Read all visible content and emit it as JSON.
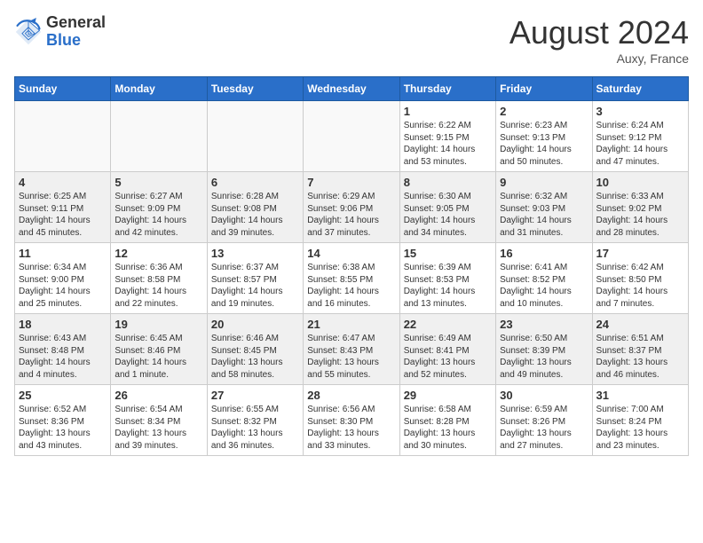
{
  "header": {
    "logo_general": "General",
    "logo_blue": "Blue",
    "month_title": "August 2024",
    "subtitle": "Auxy, France"
  },
  "days_of_week": [
    "Sunday",
    "Monday",
    "Tuesday",
    "Wednesday",
    "Thursday",
    "Friday",
    "Saturday"
  ],
  "weeks": [
    [
      {
        "day": "",
        "info": ""
      },
      {
        "day": "",
        "info": ""
      },
      {
        "day": "",
        "info": ""
      },
      {
        "day": "",
        "info": ""
      },
      {
        "day": "1",
        "info": "Sunrise: 6:22 AM\nSunset: 9:15 PM\nDaylight: 14 hours and 53 minutes."
      },
      {
        "day": "2",
        "info": "Sunrise: 6:23 AM\nSunset: 9:13 PM\nDaylight: 14 hours and 50 minutes."
      },
      {
        "day": "3",
        "info": "Sunrise: 6:24 AM\nSunset: 9:12 PM\nDaylight: 14 hours and 47 minutes."
      }
    ],
    [
      {
        "day": "4",
        "info": "Sunrise: 6:25 AM\nSunset: 9:11 PM\nDaylight: 14 hours and 45 minutes."
      },
      {
        "day": "5",
        "info": "Sunrise: 6:27 AM\nSunset: 9:09 PM\nDaylight: 14 hours and 42 minutes."
      },
      {
        "day": "6",
        "info": "Sunrise: 6:28 AM\nSunset: 9:08 PM\nDaylight: 14 hours and 39 minutes."
      },
      {
        "day": "7",
        "info": "Sunrise: 6:29 AM\nSunset: 9:06 PM\nDaylight: 14 hours and 37 minutes."
      },
      {
        "day": "8",
        "info": "Sunrise: 6:30 AM\nSunset: 9:05 PM\nDaylight: 14 hours and 34 minutes."
      },
      {
        "day": "9",
        "info": "Sunrise: 6:32 AM\nSunset: 9:03 PM\nDaylight: 14 hours and 31 minutes."
      },
      {
        "day": "10",
        "info": "Sunrise: 6:33 AM\nSunset: 9:02 PM\nDaylight: 14 hours and 28 minutes."
      }
    ],
    [
      {
        "day": "11",
        "info": "Sunrise: 6:34 AM\nSunset: 9:00 PM\nDaylight: 14 hours and 25 minutes."
      },
      {
        "day": "12",
        "info": "Sunrise: 6:36 AM\nSunset: 8:58 PM\nDaylight: 14 hours and 22 minutes."
      },
      {
        "day": "13",
        "info": "Sunrise: 6:37 AM\nSunset: 8:57 PM\nDaylight: 14 hours and 19 minutes."
      },
      {
        "day": "14",
        "info": "Sunrise: 6:38 AM\nSunset: 8:55 PM\nDaylight: 14 hours and 16 minutes."
      },
      {
        "day": "15",
        "info": "Sunrise: 6:39 AM\nSunset: 8:53 PM\nDaylight: 14 hours and 13 minutes."
      },
      {
        "day": "16",
        "info": "Sunrise: 6:41 AM\nSunset: 8:52 PM\nDaylight: 14 hours and 10 minutes."
      },
      {
        "day": "17",
        "info": "Sunrise: 6:42 AM\nSunset: 8:50 PM\nDaylight: 14 hours and 7 minutes."
      }
    ],
    [
      {
        "day": "18",
        "info": "Sunrise: 6:43 AM\nSunset: 8:48 PM\nDaylight: 14 hours and 4 minutes."
      },
      {
        "day": "19",
        "info": "Sunrise: 6:45 AM\nSunset: 8:46 PM\nDaylight: 14 hours and 1 minute."
      },
      {
        "day": "20",
        "info": "Sunrise: 6:46 AM\nSunset: 8:45 PM\nDaylight: 13 hours and 58 minutes."
      },
      {
        "day": "21",
        "info": "Sunrise: 6:47 AM\nSunset: 8:43 PM\nDaylight: 13 hours and 55 minutes."
      },
      {
        "day": "22",
        "info": "Sunrise: 6:49 AM\nSunset: 8:41 PM\nDaylight: 13 hours and 52 minutes."
      },
      {
        "day": "23",
        "info": "Sunrise: 6:50 AM\nSunset: 8:39 PM\nDaylight: 13 hours and 49 minutes."
      },
      {
        "day": "24",
        "info": "Sunrise: 6:51 AM\nSunset: 8:37 PM\nDaylight: 13 hours and 46 minutes."
      }
    ],
    [
      {
        "day": "25",
        "info": "Sunrise: 6:52 AM\nSunset: 8:36 PM\nDaylight: 13 hours and 43 minutes."
      },
      {
        "day": "26",
        "info": "Sunrise: 6:54 AM\nSunset: 8:34 PM\nDaylight: 13 hours and 39 minutes."
      },
      {
        "day": "27",
        "info": "Sunrise: 6:55 AM\nSunset: 8:32 PM\nDaylight: 13 hours and 36 minutes."
      },
      {
        "day": "28",
        "info": "Sunrise: 6:56 AM\nSunset: 8:30 PM\nDaylight: 13 hours and 33 minutes."
      },
      {
        "day": "29",
        "info": "Sunrise: 6:58 AM\nSunset: 8:28 PM\nDaylight: 13 hours and 30 minutes."
      },
      {
        "day": "30",
        "info": "Sunrise: 6:59 AM\nSunset: 8:26 PM\nDaylight: 13 hours and 27 minutes."
      },
      {
        "day": "31",
        "info": "Sunrise: 7:00 AM\nSunset: 8:24 PM\nDaylight: 13 hours and 23 minutes."
      }
    ]
  ]
}
